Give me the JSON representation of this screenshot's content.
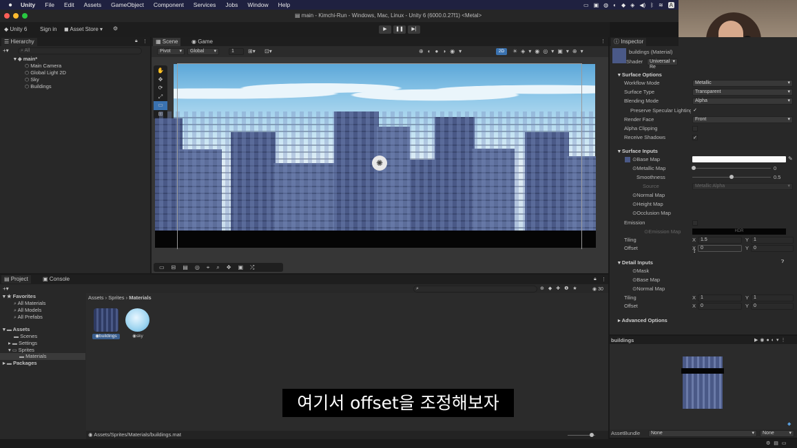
{
  "mac_menu": {
    "apple": "",
    "app": "Unity",
    "items": [
      "File",
      "Edit",
      "Assets",
      "GameObject",
      "Component",
      "Services",
      "Jobs",
      "Window",
      "Help"
    ],
    "status_a": "A"
  },
  "window_title": "main - Kimchi-Run - Windows, Mac, Linux - Unity 6 (6000.0.27f1) <Metal>",
  "toolbar": {
    "unity_label": "Unity 6",
    "sign_in": "Sign in",
    "asset_store": "Asset Store"
  },
  "hierarchy": {
    "tab": "Hierarchy",
    "search_placeholder": "All",
    "scene": "main*",
    "items": [
      "Main Camera",
      "Global Light 2D",
      "Sky",
      "Buildings"
    ]
  },
  "scene": {
    "tab_scene": "Scene",
    "tab_game": "Game",
    "pivot": "Pivot",
    "global": "Global",
    "grid_value": "1",
    "mode_2d": "2D"
  },
  "inspector": {
    "tab": "Inspector",
    "material_name": "buildings (Material)",
    "shader_label": "Shader",
    "shader_value": "Universal Re",
    "surface_options": "Surface Options",
    "workflow_mode": {
      "label": "Workflow Mode",
      "value": "Metallic"
    },
    "surface_type": {
      "label": "Surface Type",
      "value": "Transparent"
    },
    "blending_mode": {
      "label": "Blending Mode",
      "value": "Alpha"
    },
    "preserve_specular": {
      "label": "Preserve Specular Lighting",
      "checked": "✓"
    },
    "render_face": {
      "label": "Render Face",
      "value": "Front"
    },
    "alpha_clipping": {
      "label": "Alpha Clipping"
    },
    "receive_shadows": {
      "label": "Receive Shadows",
      "checked": "✓"
    },
    "surface_inputs": "Surface Inputs",
    "base_map": "Base Map",
    "metallic_map": {
      "label": "Metallic Map",
      "value": "0",
      "fraction": 0
    },
    "smoothness": {
      "label": "Smoothness",
      "value": "0.5",
      "fraction": 0.5
    },
    "source": {
      "label": "Source",
      "value": "Metallic Alpha"
    },
    "normal_map": "Normal Map",
    "height_map": "Height Map",
    "occlusion_map": "Occlusion Map",
    "emission": "Emission",
    "emission_map": "Emission Map",
    "hdr": "HDR",
    "tiling": {
      "label": "Tiling",
      "x_label": "X",
      "x": "1.5",
      "y_label": "Y",
      "y": "1"
    },
    "offset": {
      "label": "Offset",
      "x_label": "X",
      "x": "0",
      "y_label": "Y",
      "y": "0"
    },
    "detail_inputs": "Detail Inputs",
    "mask": "Mask",
    "d_base_map": "Base Map",
    "d_normal_map": "Normal Map",
    "d_tiling": {
      "label": "Tiling",
      "x_label": "X",
      "x": "1",
      "y_label": "Y",
      "y": "1"
    },
    "d_offset": {
      "label": "Offset",
      "x_label": "X",
      "x": "0",
      "y_label": "Y",
      "y": "0"
    },
    "advanced": "Advanced Options",
    "preview_name": "buildings",
    "asset_bundle": {
      "label": "AssetBundle",
      "value": "None",
      "variant": "None"
    }
  },
  "project": {
    "tab_project": "Project",
    "tab_console": "Console",
    "favorites": "Favorites",
    "fav_items": [
      "All Materials",
      "All Models",
      "All Prefabs"
    ],
    "assets": "Assets",
    "folders": [
      "Scenes",
      "Settings",
      "Sprites",
      "Materials"
    ],
    "packages": "Packages",
    "breadcrumb": [
      "Assets",
      "Sprites",
      "Materials"
    ],
    "files": [
      {
        "name": "buildings"
      },
      {
        "name": "sky"
      }
    ],
    "path": "Assets/Sprites/Materials/buildings.mat",
    "count": "30"
  },
  "subtitle": "여기서 offset을 조정해보자",
  "colors": {
    "menubar": "#1f2140",
    "sky": "#a9d3ee",
    "building": "#4a5a88",
    "accent": "#3a72b0"
  }
}
